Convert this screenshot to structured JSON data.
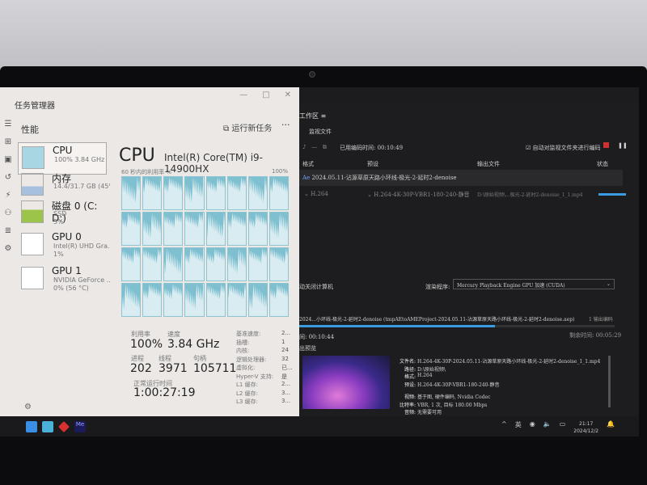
{
  "task_manager": {
    "title": "任务管理器",
    "window_buttons": [
      "—",
      "□",
      "✕"
    ],
    "section": "性能",
    "run_new_task": "运行新任务",
    "more": "···",
    "rail_icons": [
      "menu-icon",
      "processes-icon",
      "performance-icon",
      "history-icon",
      "startup-icon",
      "users-icon",
      "details-icon",
      "services-icon"
    ],
    "sidebar": [
      {
        "name": "CPU",
        "sub1": "100% 3.84 GHz",
        "sub2": ""
      },
      {
        "name": "内存",
        "sub1": "14.4/31.7 GB (45%)",
        "sub2": ""
      },
      {
        "name": "磁盘 0 (C: D:)",
        "sub1": "SSD",
        "sub2": "5%"
      },
      {
        "name": "GPU 0",
        "sub1": "Intel(R) UHD Gra...",
        "sub2": "1%"
      },
      {
        "name": "GPU 1",
        "sub1": "NVIDIA GeForce ...",
        "sub2": "0% (56 °C)"
      }
    ],
    "cpu": {
      "title": "CPU",
      "model": "Intel(R) Core(TM) i9-14900HX",
      "graph_label": "60 秒内的利用率 %",
      "graph_max": "100%",
      "utilization_label": "利用率",
      "utilization": "100%",
      "speed_label": "速度",
      "speed": "3.84 GHz",
      "processes_label": "进程",
      "processes": "202",
      "threads_label": "线程",
      "threads": "3971",
      "handles_label": "句柄",
      "handles": "105711",
      "uptime_label": "正常运行时间",
      "uptime": "1:00:27:19",
      "specs": [
        [
          "基准速度:",
          "2..."
        ],
        [
          "插槽:",
          "1"
        ],
        [
          "内核:",
          "24"
        ],
        [
          "逻辑处理器:",
          "32"
        ],
        [
          "虚拟化:",
          "已..."
        ],
        [
          "Hyper-V 支持:",
          "是"
        ],
        [
          "L1 缓存:",
          "2..."
        ],
        [
          "L2 缓存:",
          "3..."
        ],
        [
          "L3 缓存:",
          "3..."
        ]
      ]
    }
  },
  "media_encoder": {
    "workspace": "工作区 ≡",
    "tab": "监视文件",
    "elapsed": "已用编码时间: 00:10:49",
    "auto_encode": "自动对监视文件夹进行编码",
    "columns": [
      "格式",
      "预设",
      "输出文件",
      "状态"
    ],
    "queue_item": "2024.05.11-沾源草原天路小环线-极光-2-延时2-denoise",
    "format": "H.264",
    "preset": "H.264-4K-30P-VBR1-180-240-静音",
    "output": "D:\\原始视频\\...极光-2-延时2-denoise_1_1.mp4",
    "shutdown": "动关闭计算机",
    "renderer_label": "渲染程序:",
    "renderer": "Mercury Playback Engine GPU 加速 (CUDA)",
    "encoding_title": "2024...小环线-极光-2-延时2-denoise (tmpAEtoAMEProject-2024.05.11-沾源草原天路小环线-极光-2-延时2-denoise.aep)",
    "outputs_count": "1 输出编码",
    "progress": 0.62,
    "time_elapsed": "间: 00:10:44",
    "time_remaining": "剩余时间: 00:05:29",
    "preview_label": "出预览",
    "details": [
      [
        "文件名:",
        "H.264-4K-30P-2024.05.11-沾源草原天路小环线-极光-2-延时2-denoise_1_1.mp4"
      ],
      [
        "路径:",
        "D:\\原始视频\\"
      ],
      [
        "格式:",
        "H.264"
      ],
      [
        "预设:",
        "H.264-4K-30P-VBR1-180-240-静音"
      ],
      [
        "视频:",
        "基于图, 硬件编码, Nvidia Codec"
      ],
      [
        "比特率:",
        "VBR, 1 次, 目标 180.00 Mbps"
      ],
      [
        "音频:",
        "无需要可用"
      ]
    ]
  },
  "taskbar": {
    "ime": "英",
    "clock_time": "21:17",
    "clock_date": "2024/12/2"
  }
}
